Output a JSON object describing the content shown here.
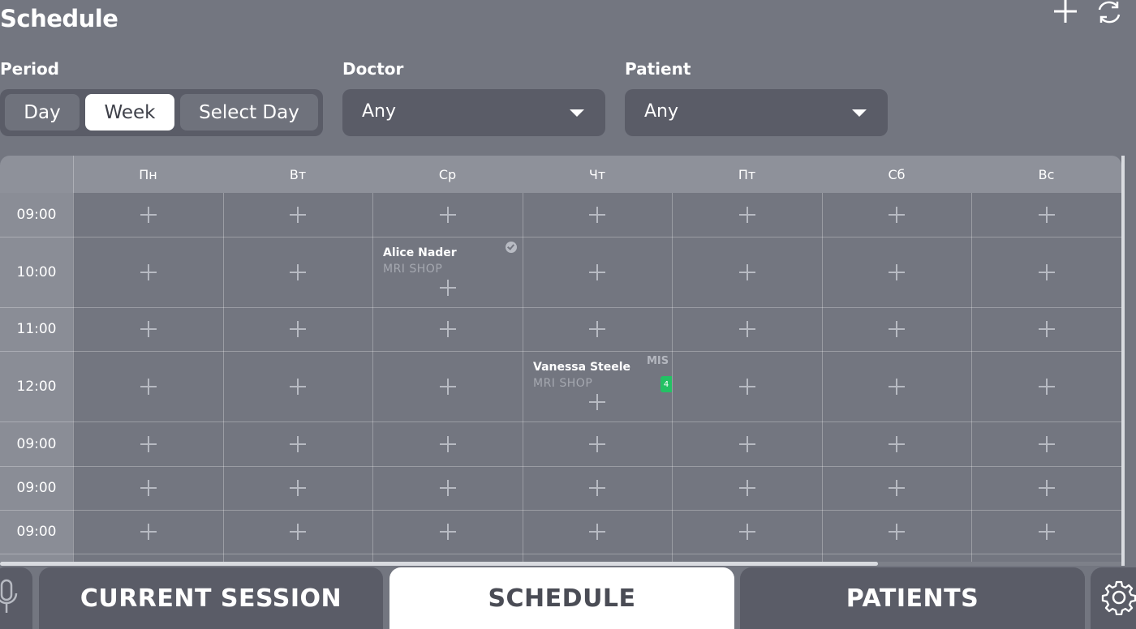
{
  "header": {
    "title": "Schedule",
    "add_icon": "plus-icon",
    "refresh_icon": "refresh-icon"
  },
  "filters": {
    "period_label": "Period",
    "period_options": [
      "Day",
      "Week",
      "Select Day"
    ],
    "period_selected": "Week",
    "doctor_label": "Doctor",
    "doctor_value": "Any",
    "patient_label": "Patient",
    "patient_value": "Any"
  },
  "grid": {
    "days": [
      "Пн",
      "Вт",
      "Ср",
      "Чт",
      "Пт",
      "Сб",
      "Вс"
    ],
    "times": [
      "09:00",
      "10:00",
      "11:00",
      "12:00",
      "09:00",
      "09:00",
      "09:00"
    ],
    "appointments": [
      {
        "name": "Alice Nader",
        "sub": "MRI SHOP",
        "day_index": 2,
        "row_index": 1,
        "confirmed": true
      },
      {
        "name": "Vanessa Steele",
        "sub": "MRI SHOP",
        "day_index": 3,
        "row_index": 3,
        "tag": "MIS",
        "badge": "4"
      }
    ]
  },
  "tabs": {
    "current_session": "CURRENT SESSION",
    "schedule": "SCHEDULE",
    "patients": "PATIENTS",
    "active": "SCHEDULE"
  },
  "icons": {
    "mic": "microphone-icon",
    "settings": "gear-icon"
  },
  "colors": {
    "background": "#737680",
    "panel": "#5a5c67",
    "header_row": "#8e919a",
    "badge": "#23c164",
    "active": "#ffffff"
  }
}
